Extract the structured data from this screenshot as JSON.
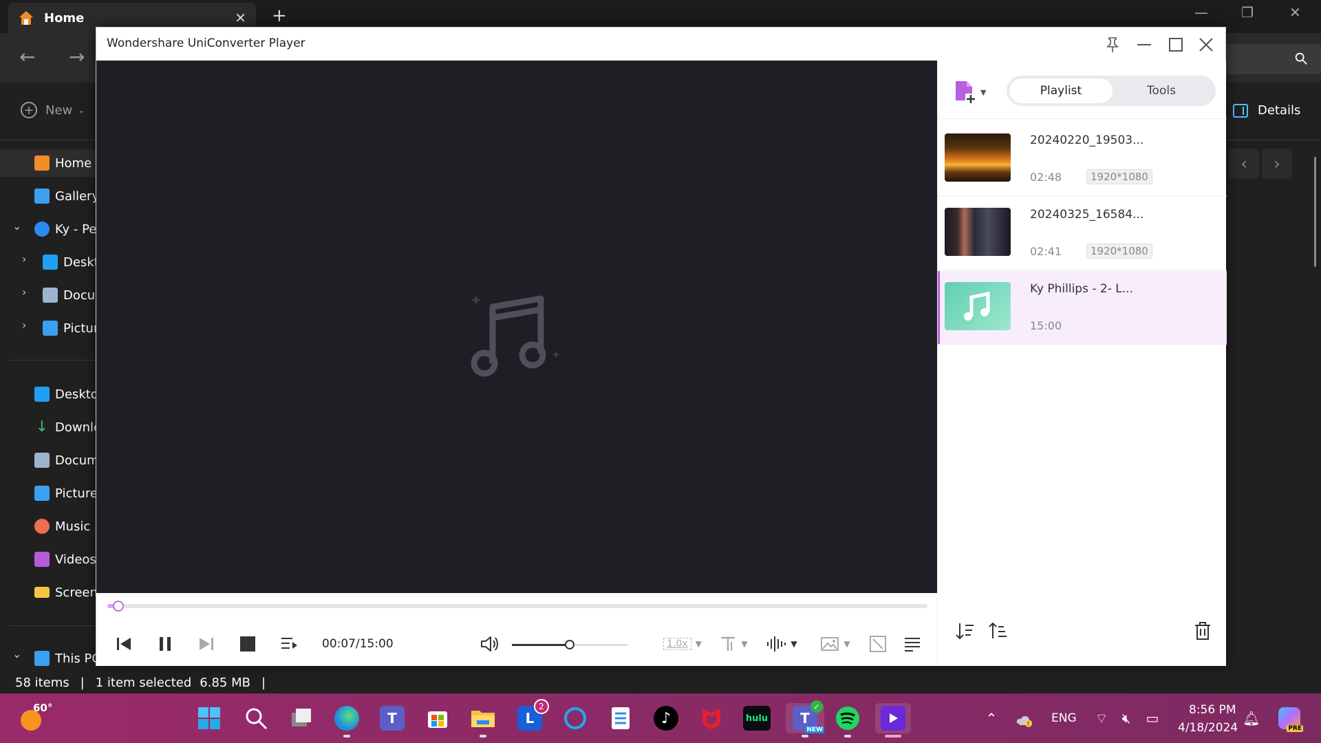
{
  "explorer": {
    "tab_title": "Home",
    "new_label": "New",
    "details_label": "Details",
    "sidebar": [
      {
        "label": "Home",
        "icon": "home-icon",
        "color": "#f28c28"
      },
      {
        "label": "Gallery",
        "icon": "gallery-icon",
        "color": "#3ba0f0"
      },
      {
        "label": "Ky - Per",
        "icon": "onedrive-icon",
        "color": "#2b8cf0"
      },
      {
        "label": "Deskt",
        "icon": "desktop-icon",
        "color": "#1ea1f1"
      },
      {
        "label": "Docur",
        "icon": "documents-icon",
        "color": "#9db4d0"
      },
      {
        "label": "Pictur",
        "icon": "pictures-icon",
        "color": "#3ba0f0"
      },
      {
        "label": "Deskto",
        "icon": "desktop-icon",
        "color": "#1ea1f1"
      },
      {
        "label": "Downlc",
        "icon": "downloads-icon",
        "color": "#36c26a"
      },
      {
        "label": "Docum",
        "icon": "documents-icon",
        "color": "#9db4d0"
      },
      {
        "label": "Pictures",
        "icon": "pictures-icon",
        "color": "#3ba0f0"
      },
      {
        "label": "Music",
        "icon": "music-icon",
        "color": "#f06d4f"
      },
      {
        "label": "Videos",
        "icon": "videos-icon",
        "color": "#b45cd8"
      },
      {
        "label": "Screens",
        "icon": "folder-icon",
        "color": "#f5c542"
      },
      {
        "label": "This PC",
        "icon": "pc-icon",
        "color": "#3ba0f0"
      }
    ],
    "status": {
      "items": "58 items",
      "selected": "1 item selected",
      "size": "6.85 MB"
    }
  },
  "player": {
    "title": "Wondershare UniConverter Player",
    "tabs": {
      "playlist": "Playlist",
      "tools": "Tools"
    },
    "progress_fraction": 0.008,
    "time": "00:07/15:00",
    "volume_fraction": 0.5,
    "speed_label": "1.0x",
    "accent": "#b85fe0",
    "playlist": [
      {
        "name": "20240220_19503...",
        "duration": "02:48",
        "resolution": "1920*1080",
        "thumb": "video-thumb-sunset"
      },
      {
        "name": "20240325_16584...",
        "duration": "02:41",
        "resolution": "1920*1080",
        "thumb": "video-thumb-dark"
      },
      {
        "name": "Ky Phillips - 2- L...",
        "duration": "15:00",
        "resolution": "",
        "thumb": "music-thumb",
        "current": true
      }
    ]
  },
  "taskbar": {
    "weather_temp": "60°",
    "lightning_badge": "2",
    "apps": [
      "start-icon",
      "search-icon",
      "task-view-icon",
      "edge-icon",
      "teams-icon",
      "store-icon",
      "file-explorer-icon",
      "lightning-icon",
      "cortana-icon",
      "notes-icon",
      "tiktok-icon",
      "mcafee-icon",
      "hulu-icon",
      "teams-new-icon",
      "spotify-icon",
      "uniconverter-icon"
    ],
    "hulu_label": "hulu",
    "new_badge": "NEW",
    "lang": "ENG",
    "time": "8:56 PM",
    "date": "4/18/2024",
    "copilot_badge": "PRE"
  }
}
